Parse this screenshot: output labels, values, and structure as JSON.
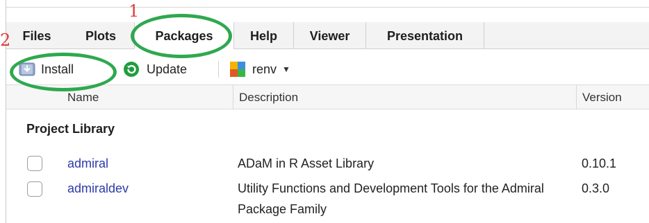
{
  "tabs": [
    {
      "label": "Files"
    },
    {
      "label": "Plots"
    },
    {
      "label": "Packages"
    },
    {
      "label": "Help"
    },
    {
      "label": "Viewer"
    },
    {
      "label": "Presentation"
    }
  ],
  "toolbar": {
    "install_label": "Install",
    "update_label": "Update",
    "renv_label": "renv"
  },
  "table": {
    "columns": [
      "Name",
      "Description",
      "Version"
    ],
    "section_header": "Project Library",
    "rows": [
      {
        "name": "admiral",
        "description": "ADaM in R Asset Library",
        "version": "0.10.1"
      },
      {
        "name": "admiraldev",
        "description": "Utility Functions and Development Tools for the Admiral Package Family",
        "version": "0.3.0"
      }
    ]
  },
  "annotations": {
    "label_1": "1",
    "label_2": "2"
  },
  "colors": {
    "annotation_ring": "#2fa84f",
    "annotation_number": "#e03a3a",
    "package_link": "#2b3aa8",
    "update_icon": "#1f9e3e"
  },
  "icons": [
    "install-icon",
    "update-icon",
    "renv-icon",
    "caret-down-icon",
    "checkbox"
  ]
}
